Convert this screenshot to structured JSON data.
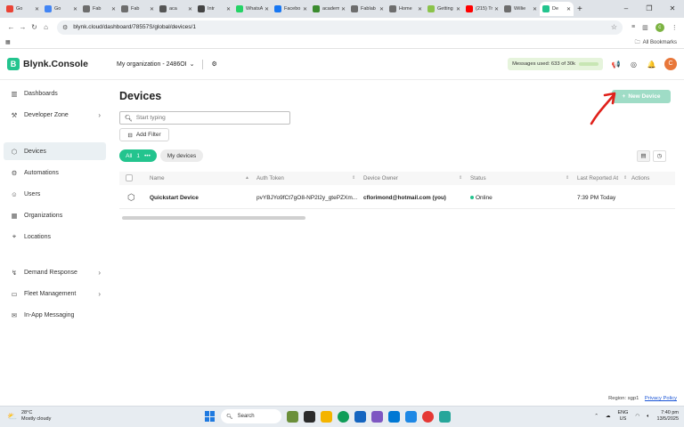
{
  "browser": {
    "tabs": [
      {
        "label": "Go",
        "color": "#ea4335"
      },
      {
        "label": "Go",
        "color": "#4285f4"
      },
      {
        "label": "Fab",
        "color": "#6d6d6d"
      },
      {
        "label": "Fab",
        "color": "#6d6d6d"
      },
      {
        "label": "aca",
        "color": "#555555"
      },
      {
        "label": "Intr",
        "color": "#444444"
      },
      {
        "label": "WhatsA",
        "color": "#25d366"
      },
      {
        "label": "Facebo",
        "color": "#1877f2"
      },
      {
        "label": "academ",
        "color": "#3b8b2e"
      },
      {
        "label": "Fablab",
        "color": "#6d6d6d"
      },
      {
        "label": "Home",
        "color": "#6d6d6d"
      },
      {
        "label": "Getting",
        "color": "#8bc34a"
      },
      {
        "label": "(215) Tr",
        "color": "#ff0000"
      },
      {
        "label": "Willie",
        "color": "#6d6d6d"
      },
      {
        "label": "De",
        "color": "#23c48e",
        "active": true
      }
    ],
    "url": "blynk.cloud/dashboard/78557S/global/devices/1",
    "all_bookmarks": "All Bookmarks"
  },
  "header": {
    "logo_letter": "B",
    "app_name": "Blynk.Console",
    "org_name": "My organization - 2486OI",
    "messages_used": "Messages used: 633 of 30k",
    "avatar_initial": "C"
  },
  "sidebar": {
    "items": [
      {
        "label": "Dashboards",
        "icon": "dashboard-icon"
      },
      {
        "label": "Developer Zone",
        "icon": "developer-zone-icon",
        "expandable": true
      },
      {
        "label": "Devices",
        "icon": "devices-icon",
        "active": true
      },
      {
        "label": "Automations",
        "icon": "automations-icon"
      },
      {
        "label": "Users",
        "icon": "users-icon"
      },
      {
        "label": "Organizations",
        "icon": "organizations-icon"
      },
      {
        "label": "Locations",
        "icon": "locations-icon"
      },
      {
        "label": "Demand Response",
        "icon": "demand-response-icon",
        "expandable": true
      },
      {
        "label": "Fleet Management",
        "icon": "fleet-management-icon",
        "expandable": true
      },
      {
        "label": "In-App Messaging",
        "icon": "in-app-messaging-icon"
      }
    ]
  },
  "main": {
    "title": "Devices",
    "new_device_label": "New Device",
    "search_placeholder": "Start typing",
    "add_filter_label": "Add Filter",
    "filter_all_label": "All",
    "filter_all_count": "1",
    "filter_mine_label": "My devices",
    "table": {
      "headers": [
        "Name",
        "Auth Token",
        "Device Owner",
        "Status",
        "Last Reported At",
        "Actions"
      ],
      "rows": [
        {
          "name": "Quickstart Device",
          "auth_token": "pvYBJYo9fCt7gO8-NP2l2y_gtePZXm...",
          "owner": "cflorimond@hotmail.com (you)",
          "status": "Online",
          "last_reported": "7:39 PM Today"
        }
      ]
    },
    "status_color": "#23c48e",
    "accent_color": "#23c48e"
  },
  "footer": {
    "region": "Region: sgp1",
    "privacy": "Privacy Policy"
  },
  "taskbar": {
    "temperature": "28°C",
    "weather": "Mostly cloudy",
    "search_label": "Search",
    "lang_top": "ENG",
    "lang_bottom": "US",
    "time": "7:40 pm",
    "date": "13/5/2025"
  }
}
